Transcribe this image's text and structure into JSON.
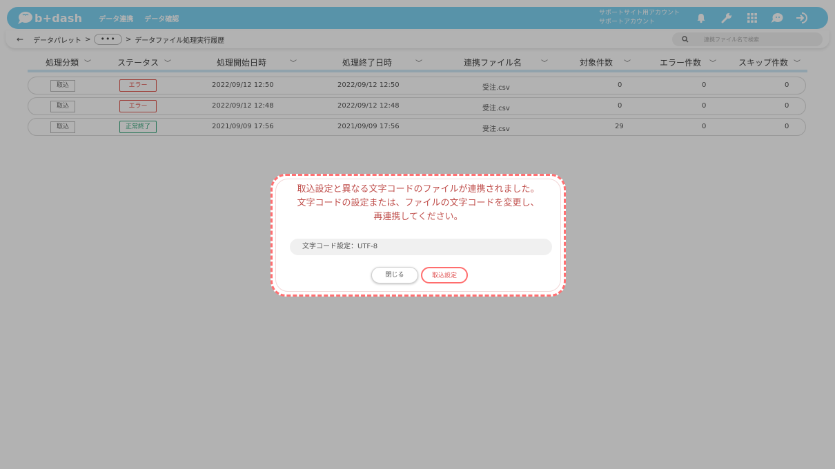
{
  "header": {
    "logo_text": "b+dash",
    "nav": [
      "データ連携",
      "データ確認"
    ],
    "account_line1": "サポートサイト用アカウント",
    "account_line2": "サポートアカウント",
    "icons": [
      "bell-icon",
      "wrench-icon",
      "grid-icon",
      "chat-icon",
      "logout-icon"
    ]
  },
  "breadcrumb": {
    "back": "←",
    "item1": "データパレット",
    "sep": ">",
    "ellipsis": "•••",
    "item2": "データファイル処理実行履歴"
  },
  "search": {
    "placeholder": "連携ファイル名で検索"
  },
  "table": {
    "columns": [
      "処理分類",
      "ステータス",
      "処理開始日時",
      "処理終了日時",
      "連携ファイル名",
      "対象件数",
      "エラー件数",
      "スキップ件数"
    ],
    "rows": [
      {
        "type": "取込",
        "status": "エラー",
        "status_kind": "error",
        "start": "2022/09/12 12:50",
        "end": "2022/09/12 12:50",
        "file": "受注.csv",
        "target": "0",
        "error": "0",
        "skip": "0"
      },
      {
        "type": "取込",
        "status": "エラー",
        "status_kind": "error",
        "start": "2022/09/12 12:48",
        "end": "2022/09/12 12:48",
        "file": "受注.csv",
        "target": "0",
        "error": "0",
        "skip": "0"
      },
      {
        "type": "取込",
        "status": "正常終了",
        "status_kind": "ok",
        "start": "2021/09/09 17:56",
        "end": "2021/09/09 17:56",
        "file": "受注.csv",
        "target": "29",
        "error": "0",
        "skip": "0"
      }
    ]
  },
  "dialog": {
    "line1": "取込設定と異なる文字コードのファイルが連携されました。",
    "line2": "文字コードの設定または、ファイルの文字コードを変更し、",
    "line3": "再連携してください。",
    "code_setting": "文字コード設定：UTF-8",
    "close_label": "閉じる",
    "settings_label": "取込設定"
  },
  "colors": {
    "header_bg": "#7fd3f3",
    "error": "#e0564e",
    "ok": "#37a87d",
    "dialog_border": "#ff7072",
    "dialog_text": "#c0504d"
  }
}
